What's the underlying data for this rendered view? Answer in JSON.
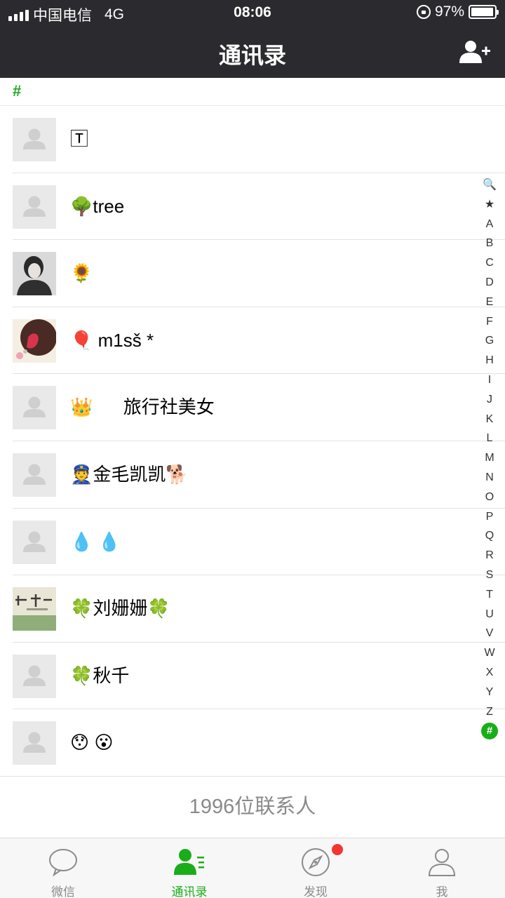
{
  "status": {
    "carrier": "中国电信",
    "network": "4G",
    "time": "08:06",
    "battery_percent": "97%",
    "battery_level": 0.97
  },
  "header": {
    "title": "通讯录",
    "add_contact_icon": "add-contact-icon"
  },
  "section_header": "#",
  "contacts": [
    {
      "name": "🅃",
      "avatar": "default"
    },
    {
      "name": "🌳tree",
      "avatar": "default"
    },
    {
      "name": "🌻",
      "avatar": "photo"
    },
    {
      "name": "🎈 m1sš *",
      "avatar": "photo"
    },
    {
      "name": "👑      旅行社美女",
      "avatar": "default"
    },
    {
      "name": "👮金毛凯凯🐕",
      "avatar": "default"
    },
    {
      "name": "💧 💧",
      "avatar": "default"
    },
    {
      "name": "🍀刘姗姗🍀",
      "avatar": "photo"
    },
    {
      "name": "🍀秋千",
      "avatar": "default"
    },
    {
      "name": "😯 😮",
      "avatar": "default"
    }
  ],
  "index_letters": [
    "🔍",
    "★",
    "A",
    "B",
    "C",
    "D",
    "E",
    "F",
    "G",
    "H",
    "I",
    "J",
    "K",
    "L",
    "M",
    "N",
    "O",
    "P",
    "Q",
    "R",
    "S",
    "T",
    "U",
    "V",
    "W",
    "X",
    "Y",
    "Z"
  ],
  "index_active": "#",
  "footer_count": "1996位联系人",
  "tabs": [
    {
      "label": "微信",
      "icon": "chat-bubble-icon"
    },
    {
      "label": "通讯录",
      "icon": "contacts-icon"
    },
    {
      "label": "发现",
      "icon": "compass-icon"
    },
    {
      "label": "我",
      "icon": "person-icon"
    }
  ],
  "colors": {
    "accent": "#1aad19",
    "header_bg": "#2b2b2f",
    "badge": "#f43530"
  }
}
